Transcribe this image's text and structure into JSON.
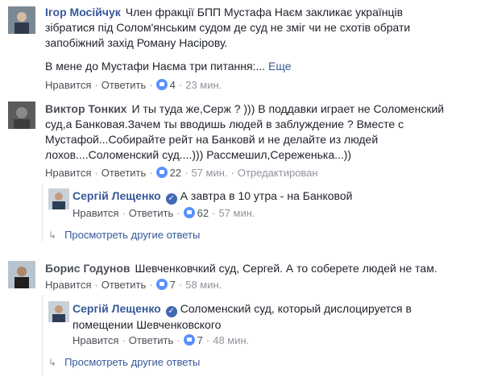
{
  "actions": {
    "like": "Нравится",
    "reply": "Ответить",
    "more": "Еще",
    "show_replies": "Просмотреть другие ответы",
    "edited": "Отредактирован"
  },
  "comments": [
    {
      "author": "Ігор Мосійчук",
      "text_lines": [
        "Член фракції БПП Мустафа Наєм закликає українців",
        "зібратися під Солом'янським судом де суд не зміг чи не схотів обрати",
        "запобіжний захід Роману Насірову."
      ],
      "text2": "В мене до Мустафи Наєма три питання:...",
      "likes": "4",
      "time": "23 мин."
    },
    {
      "author": "Виктор Тонких",
      "text_lines": [
        "И ты туда же,Серж ? ))) В поддавки играет не Соломенский",
        "суд,а Банковая.Зачем ты вводишь людей в заблуждение ? Вместе с",
        "Мустафой...Собирайте рейт на Банковй и не делайте из людей",
        "лохов....Соломенский суд....))) Рассмешил,Сереженька...))"
      ],
      "likes": "22",
      "time": "57 мин."
    },
    {
      "author": "Сергій Лещенко",
      "text": "А завтра в 10 утра - на Банковой",
      "likes": "62",
      "time": "57 мин."
    },
    {
      "author": "Борис Годунов",
      "text": "Шевченковчкий суд, Сергей. А то соберете людей не там.",
      "likes": "7",
      "time": "58 мин."
    },
    {
      "author": "Сергій Лещенко",
      "text_lines": [
        "Соломенский суд, который дислоцируется в",
        "помещении Шевченковского"
      ],
      "likes": "7",
      "time": "48 мин."
    }
  ],
  "colors": {
    "link": "#365899",
    "meta": "#90949c",
    "like_blue": "#5890ff",
    "verified": "#4267b2"
  }
}
